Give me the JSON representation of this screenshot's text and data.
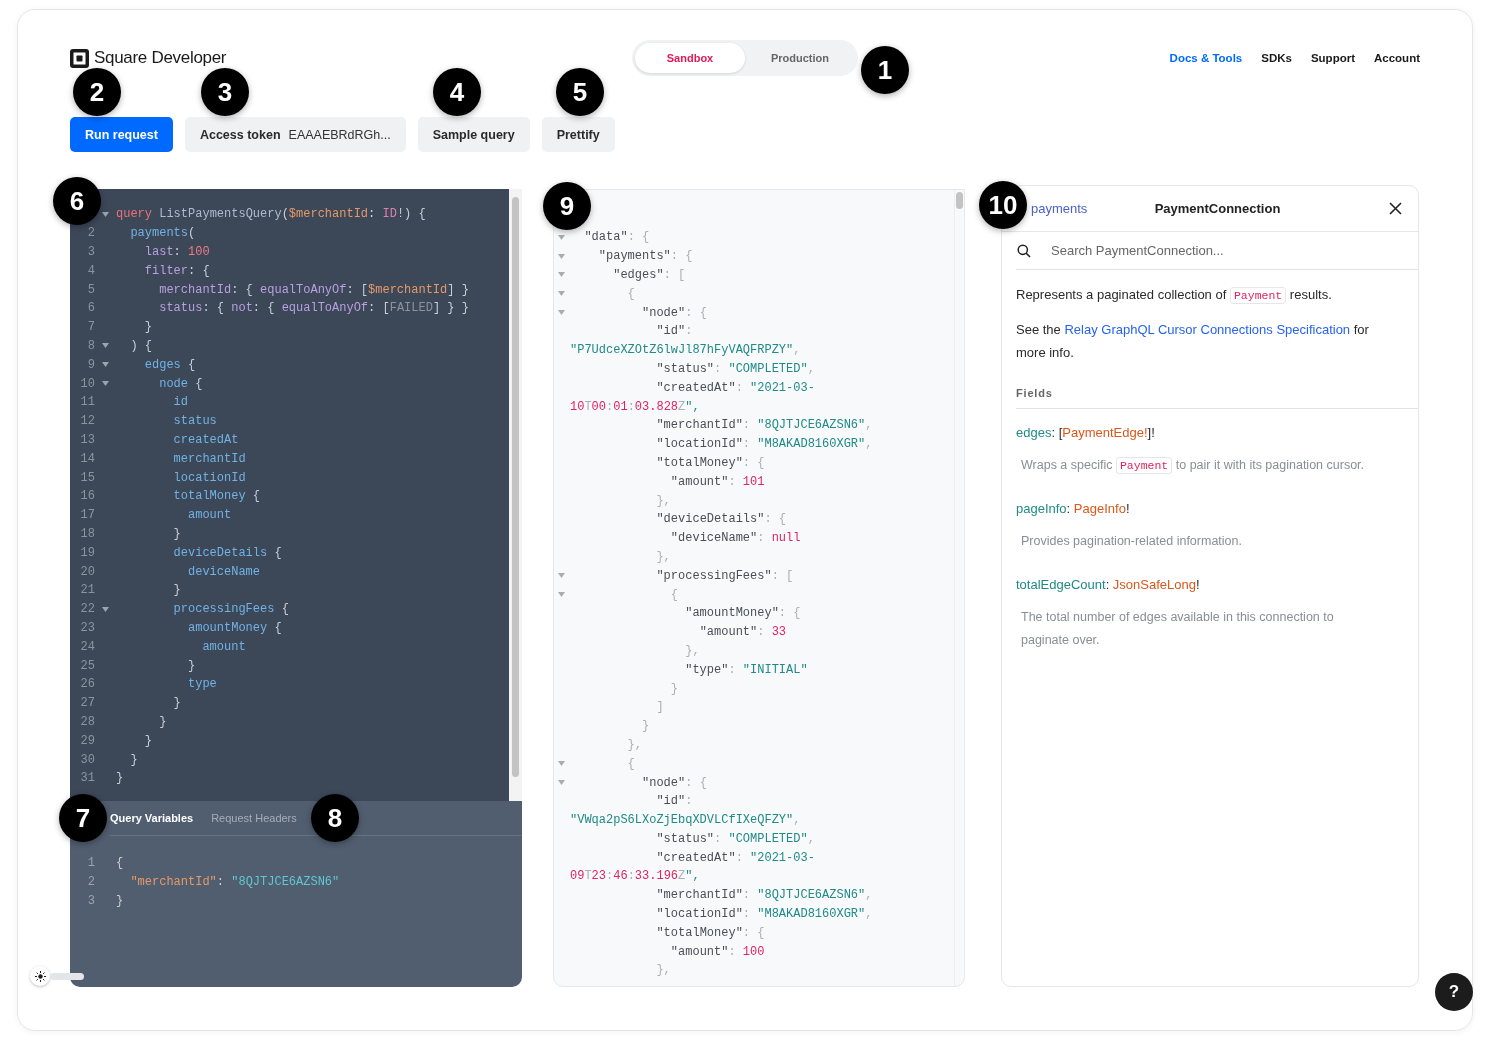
{
  "header": {
    "logo": "Square Developer",
    "environments": [
      {
        "label": "Sandbox",
        "selected": true
      },
      {
        "label": "Production",
        "selected": false
      }
    ],
    "nav": [
      {
        "label": "Docs & Tools",
        "kind": "primary"
      },
      {
        "label": "SDKs",
        "kind": "plain"
      },
      {
        "label": "Support",
        "kind": "plain"
      },
      {
        "label": "Account",
        "kind": "plain"
      }
    ]
  },
  "toolbar": {
    "run": "Run request",
    "token_label": "Access token",
    "token_value": "EAAAEBRdRGh...",
    "sample": "Sample query",
    "prettify": "Prettify"
  },
  "editor": {
    "lines": [
      {
        "foldable": true,
        "tokens": [
          {
            "kind": "keyword",
            "text": "query"
          },
          {
            "kind": "def",
            "text": " ListPaymentsQuery"
          },
          {
            "kind": "punct",
            "text": "("
          },
          {
            "kind": "variable",
            "text": "$merchantId"
          },
          {
            "kind": "punct",
            "text": ": "
          },
          {
            "kind": "type",
            "text": "ID"
          },
          {
            "kind": "punct",
            "text": "!) {"
          }
        ]
      },
      {
        "number": "2",
        "foldable": false,
        "tokens": [
          {
            "kind": "property",
            "text": "  payments"
          },
          {
            "kind": "punct",
            "text": "("
          }
        ]
      },
      {
        "number": "3",
        "foldable": false,
        "tokens": [
          {
            "kind": "argument",
            "text": "    last"
          },
          {
            "kind": "punct",
            "text": ": "
          },
          {
            "kind": "number",
            "text": "100"
          }
        ]
      },
      {
        "number": "4",
        "foldable": false,
        "tokens": [
          {
            "kind": "argument",
            "text": "    filter"
          },
          {
            "kind": "punct",
            "text": ": {"
          }
        ]
      },
      {
        "number": "5",
        "foldable": false,
        "tokens": [
          {
            "kind": "argument",
            "text": "      merchantId"
          },
          {
            "kind": "punct",
            "text": ": { "
          },
          {
            "kind": "argument",
            "text": "equalToAnyOf"
          },
          {
            "kind": "punct",
            "text": ": ["
          },
          {
            "kind": "variable",
            "text": "$merchantId"
          },
          {
            "kind": "punct",
            "text": "] }"
          }
        ]
      },
      {
        "number": "6",
        "foldable": false,
        "tokens": [
          {
            "kind": "argument",
            "text": "      status"
          },
          {
            "kind": "punct",
            "text": ": { "
          },
          {
            "kind": "argument",
            "text": "not"
          },
          {
            "kind": "punct",
            "text": ": { "
          },
          {
            "kind": "argument",
            "text": "equalToAnyOf"
          },
          {
            "kind": "punct",
            "text": ": ["
          },
          {
            "kind": "enum",
            "text": "FAILED"
          },
          {
            "kind": "punct",
            "text": "] } }"
          }
        ]
      },
      {
        "number": "7",
        "foldable": false,
        "tokens": [
          {
            "kind": "punct",
            "text": "    }"
          }
        ]
      },
      {
        "number": "8",
        "foldable": true,
        "tokens": [
          {
            "kind": "punct",
            "text": "  ) {"
          }
        ]
      },
      {
        "number": "9",
        "foldable": true,
        "tokens": [
          {
            "kind": "property",
            "text": "    edges"
          },
          {
            "kind": "punct",
            "text": " {"
          }
        ]
      },
      {
        "number": "10",
        "foldable": true,
        "tokens": [
          {
            "kind": "property",
            "text": "      node"
          },
          {
            "kind": "punct",
            "text": " {"
          }
        ]
      },
      {
        "number": "11",
        "foldable": false,
        "tokens": [
          {
            "kind": "property",
            "text": "        id"
          }
        ]
      },
      {
        "number": "12",
        "foldable": false,
        "tokens": [
          {
            "kind": "property",
            "text": "        status"
          }
        ]
      },
      {
        "number": "13",
        "foldable": false,
        "tokens": [
          {
            "kind": "property",
            "text": "        createdAt"
          }
        ]
      },
      {
        "number": "14",
        "foldable": false,
        "tokens": [
          {
            "kind": "property",
            "text": "        merchantId"
          }
        ]
      },
      {
        "number": "15",
        "foldable": false,
        "tokens": [
          {
            "kind": "property",
            "text": "        locationId"
          }
        ]
      },
      {
        "number": "16",
        "foldable": false,
        "tokens": [
          {
            "kind": "property",
            "text": "        totalMoney"
          },
          {
            "kind": "punct",
            "text": " {"
          }
        ]
      },
      {
        "number": "17",
        "foldable": false,
        "tokens": [
          {
            "kind": "property",
            "text": "          amount"
          }
        ]
      },
      {
        "number": "18",
        "foldable": false,
        "tokens": [
          {
            "kind": "punct",
            "text": "        }"
          }
        ]
      },
      {
        "number": "19",
        "foldable": false,
        "tokens": [
          {
            "kind": "property",
            "text": "        deviceDetails"
          },
          {
            "kind": "punct",
            "text": " {"
          }
        ]
      },
      {
        "number": "20",
        "foldable": false,
        "tokens": [
          {
            "kind": "property",
            "text": "          deviceName"
          }
        ]
      },
      {
        "number": "21",
        "foldable": false,
        "tokens": [
          {
            "kind": "punct",
            "text": "        }"
          }
        ]
      },
      {
        "number": "22",
        "foldable": true,
        "tokens": [
          {
            "kind": "property",
            "text": "        processingFees"
          },
          {
            "kind": "punct",
            "text": " {"
          }
        ]
      },
      {
        "number": "23",
        "foldable": false,
        "tokens": [
          {
            "kind": "property",
            "text": "          amountMoney"
          },
          {
            "kind": "punct",
            "text": " {"
          }
        ]
      },
      {
        "number": "24",
        "foldable": false,
        "tokens": [
          {
            "kind": "property",
            "text": "            amount"
          }
        ]
      },
      {
        "number": "25",
        "foldable": false,
        "tokens": [
          {
            "kind": "punct",
            "text": "          }"
          }
        ]
      },
      {
        "number": "26",
        "foldable": false,
        "tokens": [
          {
            "kind": "property",
            "text": "          type"
          }
        ]
      },
      {
        "number": "27",
        "foldable": false,
        "tokens": [
          {
            "kind": "punct",
            "text": "        }"
          }
        ]
      },
      {
        "number": "28",
        "foldable": false,
        "tokens": [
          {
            "kind": "punct",
            "text": "      }"
          }
        ]
      },
      {
        "number": "29",
        "foldable": false,
        "tokens": [
          {
            "kind": "punct",
            "text": "    }"
          }
        ]
      },
      {
        "number": "30",
        "foldable": false,
        "tokens": [
          {
            "kind": "punct",
            "text": "  }"
          }
        ]
      },
      {
        "number": "31",
        "foldable": false,
        "tokens": [
          {
            "kind": "punct",
            "text": "}"
          }
        ]
      }
    ],
    "tabs": [
      {
        "label": "Query Variables",
        "selected": true
      },
      {
        "label": "Request Headers",
        "selected": false
      }
    ],
    "variables": [
      {
        "number": "1",
        "text": "{"
      },
      {
        "number": "2",
        "text": "  \"merchantId\": \"8QJTJCE6AZSN6\""
      },
      {
        "number": "3",
        "text": "}"
      }
    ]
  },
  "result": {
    "lines": [
      {
        "foldable": true,
        "text": "  \"data\": {"
      },
      {
        "foldable": true,
        "text": "    \"payments\": {"
      },
      {
        "foldable": true,
        "text": "      \"edges\": ["
      },
      {
        "foldable": true,
        "text": "        {"
      },
      {
        "foldable": true,
        "text": "          \"node\": {"
      },
      {
        "foldable": false,
        "text": "            \"id\":"
      },
      {
        "foldable": false,
        "text": "\"P7UdceXZOtZ6lwJl87hFyVAQFRPZY\","
      },
      {
        "foldable": false,
        "text": "            \"status\": \"COMPLETED\","
      },
      {
        "foldable": false,
        "text": "            \"createdAt\": \"2021-03-"
      },
      {
        "foldable": false,
        "text": "10T00:01:03.828Z\","
      },
      {
        "foldable": false,
        "text": "            \"merchantId\": \"8QJTJCE6AZSN6\","
      },
      {
        "foldable": false,
        "text": "            \"locationId\": \"M8AKAD8160XGR\","
      },
      {
        "foldable": false,
        "text": "            \"totalMoney\": {"
      },
      {
        "foldable": false,
        "text": "              \"amount\": 101"
      },
      {
        "foldable": false,
        "text": "            },"
      },
      {
        "foldable": false,
        "text": "            \"deviceDetails\": {"
      },
      {
        "foldable": false,
        "text": "              \"deviceName\": null"
      },
      {
        "foldable": false,
        "text": "            },"
      },
      {
        "foldable": true,
        "text": "            \"processingFees\": ["
      },
      {
        "foldable": true,
        "text": "              {"
      },
      {
        "foldable": false,
        "text": "                \"amountMoney\": {"
      },
      {
        "foldable": false,
        "text": "                  \"amount\": 33"
      },
      {
        "foldable": false,
        "text": "                },"
      },
      {
        "foldable": false,
        "text": "                \"type\": \"INITIAL\""
      },
      {
        "foldable": false,
        "text": "              }"
      },
      {
        "foldable": false,
        "text": "            ]"
      },
      {
        "foldable": false,
        "text": "          }"
      },
      {
        "foldable": false,
        "text": "        },"
      },
      {
        "foldable": true,
        "text": "        {"
      },
      {
        "foldable": true,
        "text": "          \"node\": {"
      },
      {
        "foldable": false,
        "text": "            \"id\":"
      },
      {
        "foldable": false,
        "text": "\"VWqa2pS6LXoZjEbqXDVLCfIXeQFZY\","
      },
      {
        "foldable": false,
        "text": "            \"status\": \"COMPLETED\","
      },
      {
        "foldable": false,
        "text": "            \"createdAt\": \"2021-03-"
      },
      {
        "foldable": false,
        "text": "09T23:46:33.196Z\","
      },
      {
        "foldable": false,
        "text": "            \"merchantId\": \"8QJTJCE6AZSN6\","
      },
      {
        "foldable": false,
        "text": "            \"locationId\": \"M8AKAD8160XGR\","
      },
      {
        "foldable": false,
        "text": "            \"totalMoney\": {"
      },
      {
        "foldable": false,
        "text": "              \"amount\": 100"
      },
      {
        "foldable": false,
        "text": "            },"
      }
    ]
  },
  "docs": {
    "back": "payments",
    "title": "PaymentConnection",
    "search": {
      "placeholder": "Search PaymentConnection..."
    },
    "paragraphs": [
      [
        {
          "kind": "text",
          "text": "Represents a paginated collection of "
        },
        {
          "kind": "code",
          "text": "Payment"
        },
        {
          "kind": "text",
          "text": " results."
        }
      ],
      [
        {
          "kind": "text",
          "text": "See the "
        },
        {
          "kind": "link",
          "text": "Relay GraphQL Cursor Connections Specification"
        },
        {
          "kind": "text",
          "text": " for more info."
        }
      ]
    ],
    "fields_heading": "Fields",
    "fields": [
      {
        "signature": [
          {
            "kind": "name",
            "text": "edges"
          },
          {
            "kind": "punct",
            "text": ": ["
          },
          {
            "kind": "type",
            "text": "PaymentEdge!"
          },
          {
            "kind": "punct",
            "text": "]!"
          }
        ],
        "description": [
          {
            "kind": "text",
            "text": "Wraps a specific "
          },
          {
            "kind": "code",
            "text": "Payment"
          },
          {
            "kind": "text",
            "text": " to pair it with its pagination cursor."
          }
        ]
      },
      {
        "signature": [
          {
            "kind": "name",
            "text": "pageInfo"
          },
          {
            "kind": "punct",
            "text": ": "
          },
          {
            "kind": "type",
            "text": "PageInfo"
          },
          {
            "kind": "punct",
            "text": "!"
          }
        ],
        "description": [
          {
            "kind": "text",
            "text": "Provides pagination-related information."
          }
        ]
      },
      {
        "signature": [
          {
            "kind": "name",
            "text": "totalEdgeCount"
          },
          {
            "kind": "punct",
            "text": ": "
          },
          {
            "kind": "type",
            "text": "JsonSafeLong"
          },
          {
            "kind": "punct",
            "text": "!"
          }
        ],
        "description": [
          {
            "kind": "text",
            "text": "The total number of edges available in this connection to paginate over."
          }
        ]
      }
    ]
  },
  "help": "?",
  "callouts": [
    "1",
    "2",
    "3",
    "4",
    "5",
    "6",
    "7",
    "8",
    "9",
    "10"
  ]
}
